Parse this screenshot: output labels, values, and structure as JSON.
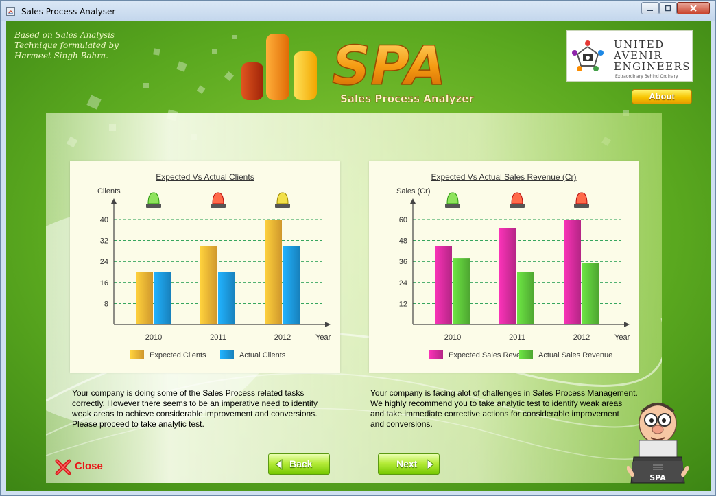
{
  "window": {
    "title": "Sales Process Analyser"
  },
  "header": {
    "credit_lines": [
      "Based on Sales Analysis",
      "Technique formulated by",
      "Harmeet Singh Bahra."
    ],
    "spa_logo_text": "SPA",
    "spa_tagline": "Sales Process Analyzer",
    "company_name_lines": [
      "UNITED",
      "AVENIR",
      "ENGINEERS"
    ],
    "company_tagline": "Extraordinary  Behind  Ordinary",
    "about_label": "About"
  },
  "charts": {
    "clients": {
      "title": "Expected Vs Actual Clients",
      "ylabel": "Clients",
      "xlabel": "Year"
    },
    "revenue": {
      "title": "Expected Vs Actual Sales Revenue (Cr)",
      "ylabel": "Sales (Cr)",
      "xlabel": "Year"
    }
  },
  "chart_data": [
    {
      "type": "bar",
      "title": "Expected Vs Actual Clients",
      "xlabel": "Year",
      "ylabel": "Clients",
      "categories": [
        "2010",
        "2011",
        "2012"
      ],
      "yticks": [
        8,
        16,
        24,
        32,
        40
      ],
      "ylim": [
        0,
        40
      ],
      "grid": true,
      "legend": "bottom",
      "status_indicators": [
        "green",
        "red",
        "yellow"
      ],
      "series": [
        {
          "name": "Expected Clients",
          "values": [
            20,
            30,
            40
          ],
          "color": "#f3b234"
        },
        {
          "name": "Actual Clients",
          "values": [
            20,
            20,
            30
          ],
          "color": "#1c98dd"
        }
      ]
    },
    {
      "type": "bar",
      "title": "Expected Vs Actual Sales Revenue (Cr)",
      "xlabel": "Year",
      "ylabel": "Sales (Cr)",
      "categories": [
        "2010",
        "2011",
        "2012"
      ],
      "yticks": [
        12,
        24,
        36,
        48,
        60
      ],
      "ylim": [
        0,
        60
      ],
      "grid": true,
      "legend": "bottom",
      "status_indicators": [
        "green",
        "red",
        "red"
      ],
      "series": [
        {
          "name": "Expected Sales Revenue",
          "values": [
            45,
            55,
            60
          ],
          "color": "#d42b9c"
        },
        {
          "name": "Actual Sales Revenue",
          "values": [
            38,
            30,
            35
          ],
          "color": "#5cc33a"
        }
      ]
    }
  ],
  "messages": {
    "left": [
      "Your company is doing some of the Sales Process related tasks",
      "correctly. However there seems to be an imperative need to identify",
      "weak areas to achieve considerable improvement and conversions.",
      "Please proceed to take analytic test."
    ],
    "right": [
      "Your company is facing alot of challenges in Sales Process Management.",
      "We highly recommend you to take analytic test to identify weak areas",
      "and take immediate corrective actions for considerable improvement",
      "and conversions."
    ]
  },
  "footer": {
    "close_label": "Close",
    "back_label": "Back",
    "next_label": "Next",
    "mascot_label": "SPA"
  },
  "colors": {
    "background_green": "#4f9a1c",
    "about_yellow": "#f7c400",
    "nav_green": "#9ee02a",
    "close_red": "#e81818"
  }
}
